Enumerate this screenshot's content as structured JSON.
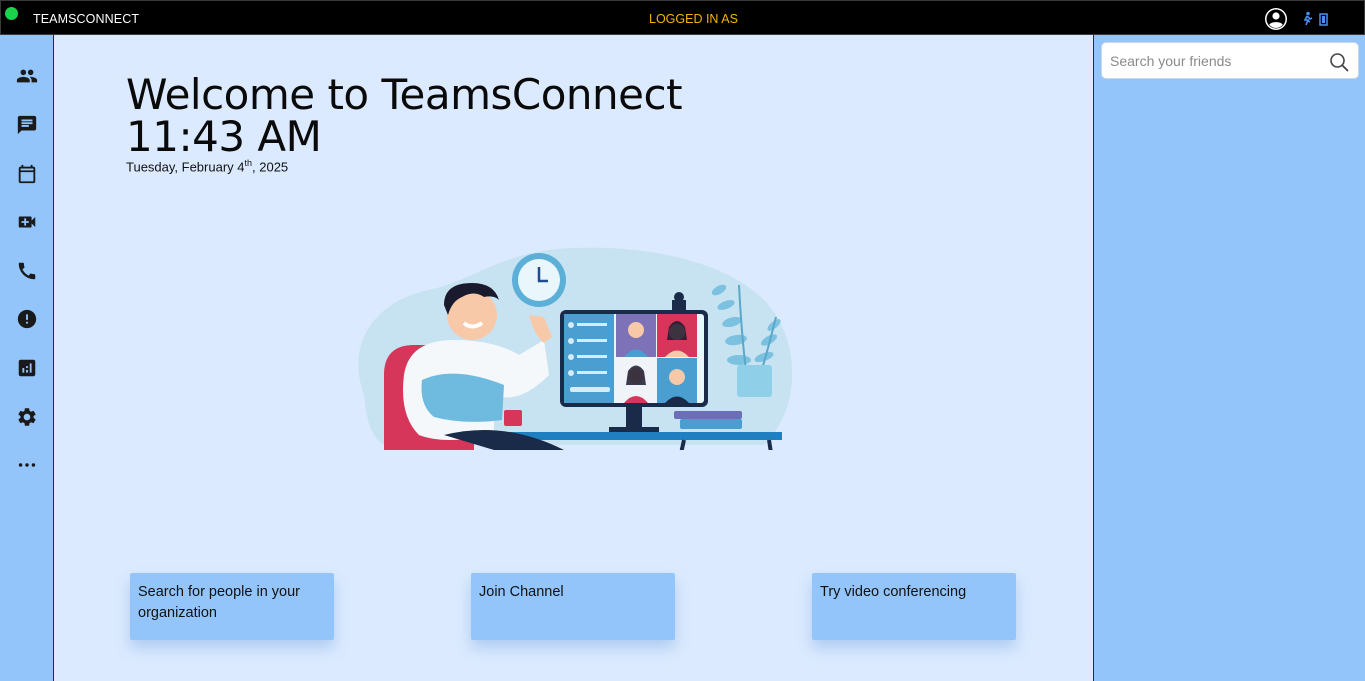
{
  "header": {
    "title": "TEAMSCONNECT",
    "login_status": "LOGGED IN AS"
  },
  "colors": {
    "sidebar": "#93c5fa",
    "main_bg": "#dbeafe",
    "status_online": "#19d34a",
    "login_text": "#f5b301"
  },
  "sidebar": {
    "items": [
      {
        "icon": "people-icon"
      },
      {
        "icon": "chat-icon"
      },
      {
        "icon": "calendar-icon"
      },
      {
        "icon": "video-add-icon"
      },
      {
        "icon": "phone-icon"
      },
      {
        "icon": "alert-icon"
      },
      {
        "icon": "analytics-icon"
      },
      {
        "icon": "settings-icon"
      },
      {
        "icon": "more-icon"
      }
    ]
  },
  "main": {
    "welcome": "Welcome to TeamsConnect",
    "time": "11:43 AM",
    "date_prefix": "Tuesday, February 4",
    "date_suffix": "th",
    "date_year": ", 2025",
    "cards": [
      {
        "label": "Search for people in your organization"
      },
      {
        "label": "Join Channel"
      },
      {
        "label": "Try video conferencing"
      }
    ]
  },
  "search": {
    "placeholder": "Search your friends"
  }
}
